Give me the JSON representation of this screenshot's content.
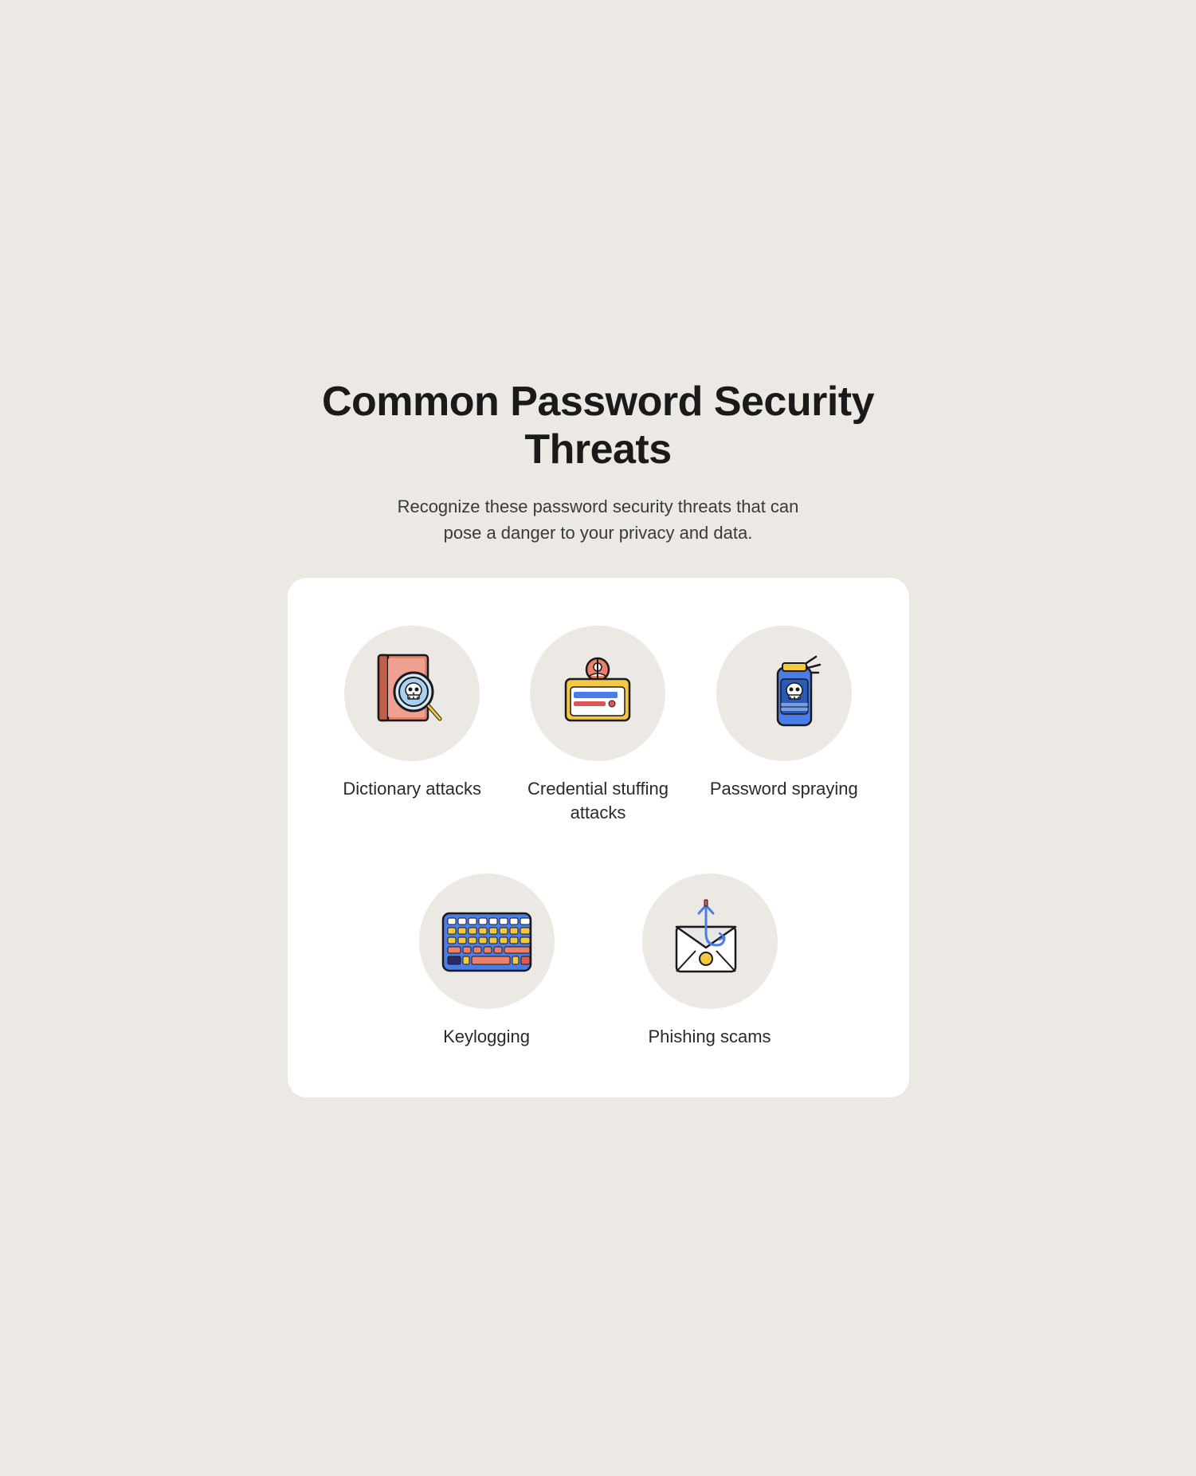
{
  "header": {
    "title": "Common Password Security Threats",
    "subtitle": "Recognize these password security threats that can pose a danger to your privacy and data."
  },
  "threats": [
    {
      "id": "dictionary-attacks",
      "label": "Dictionary attacks",
      "icon": "dictionary-icon"
    },
    {
      "id": "credential-stuffing",
      "label": "Credential stuffing attacks",
      "icon": "credential-icon"
    },
    {
      "id": "password-spraying",
      "label": "Password spraying",
      "icon": "spray-icon"
    },
    {
      "id": "keylogging",
      "label": "Keylogging",
      "icon": "keyboard-icon"
    },
    {
      "id": "phishing",
      "label": "Phishing scams",
      "icon": "phishing-icon"
    }
  ],
  "colors": {
    "background": "#ece9e4",
    "card": "#ffffff",
    "icon_circle": "#ece9e4",
    "salmon": "#e8806a",
    "yellow": "#f5c842",
    "blue": "#4a7de8",
    "dark": "#1a1a1a",
    "red": "#e05555"
  }
}
